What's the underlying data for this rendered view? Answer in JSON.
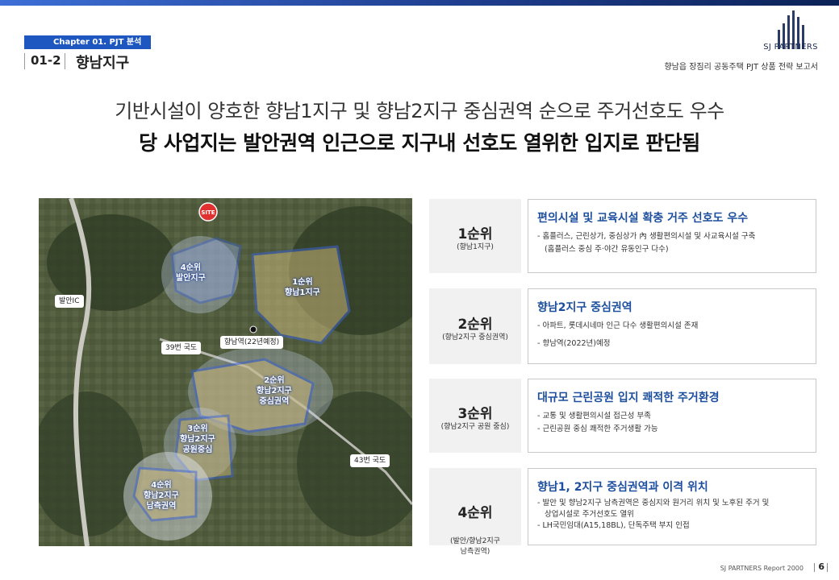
{
  "header": {
    "chapter": "Chapter 01. PJT 분석",
    "section_number": "01-2",
    "section_title": "향남지구",
    "logo_text": "SJ PARTNERS",
    "report_title": "향남읍 장짐리 공동주택 PJT 상품 전략 보고서"
  },
  "headline": {
    "line1": "기반시설이 양호한 향남1지구 및 향남2지구 중심권역 순으로 주거선호도 우수",
    "line2": "당 사업지는 발안권역 인근으로 지구내 선호도 열위한 입지로 판단됨"
  },
  "map": {
    "site_tag": "SITE",
    "labels": [
      {
        "text": "4순위\n발안지구"
      },
      {
        "text": "1순위\n향남1지구"
      },
      {
        "text": "2순위\n향남2지구\n중심권역"
      },
      {
        "text": "3순위\n향남2지구\n공원중심"
      },
      {
        "text": "4순위\n향남2지구\n남측권역"
      }
    ],
    "tags": {
      "ic": "발안IC",
      "road39": "39번 국도",
      "station": "향남역(22년예정)",
      "road43": "43번 국도"
    }
  },
  "ranks": [
    {
      "rank": "1순위",
      "area": "(향남1지구)",
      "title": "편의시설 및 교육시설 확충 거주 선호도 우수",
      "lines": [
        "- 홈플러스, 근린상가, 중심상가 內 생활편의시설 및 사교육시설 구축",
        "(홈플러스 중심 주·야간 유동인구 다수)"
      ]
    },
    {
      "rank": "2순위",
      "area": "(향남2지구 중심권역)",
      "title": "향남2지구 중심권역",
      "lines": [
        "- 아파트, 롯데시네마 인근 다수 생활편의시설 존재",
        "- 향남역(2022년)예정"
      ]
    },
    {
      "rank": "3순위",
      "area": "(향남2지구 공원 중심)",
      "title": "대규모 근린공원 입지 쾌적한 주거환경",
      "lines": [
        "- 교통 및 생활편의시설 접근성 부족",
        "- 근린공원 중심 쾌적한 주거생활 가능"
      ]
    },
    {
      "rank": "4순위",
      "area": "(발안/향남2지구\n남측권역)",
      "title": "향남1, 2지구 중심권역과 이격 위치",
      "lines": [
        "- 발안 및 향남2지구 남측권역은 중심지와 원거리 위치 및 노후된 주거 및",
        "상업시설로 주거선호도 열위",
        "- LH국민임대(A15,18BL), 단독주택 부지 인접"
      ]
    }
  ],
  "footer": {
    "report": "SJ PARTNERS Report 2000",
    "page": "6"
  }
}
